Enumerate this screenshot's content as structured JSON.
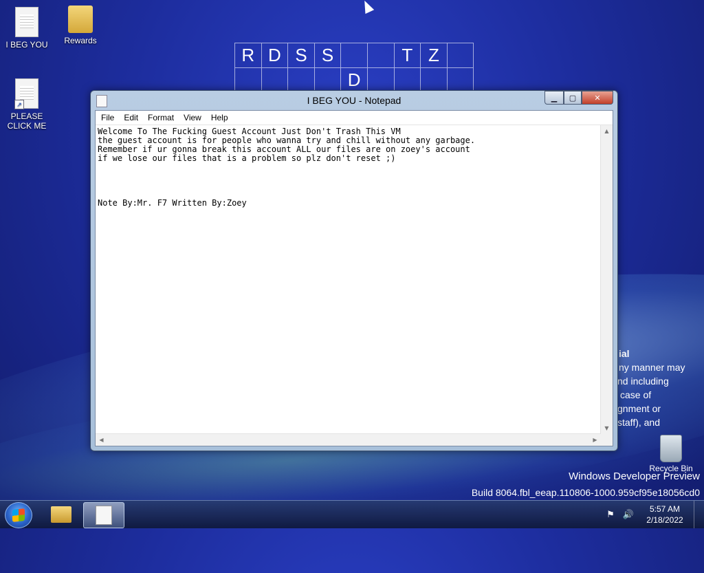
{
  "crossword": {
    "row1": [
      "R",
      "D",
      "S",
      "S",
      "",
      "",
      "T",
      "Z",
      ""
    ],
    "row2": [
      "",
      "",
      "",
      "",
      "D",
      "",
      "",
      "",
      ""
    ]
  },
  "desktop": {
    "icon_beg_you": "I BEG YOU",
    "icon_rewards": "Rewards",
    "icon_please_click": "PLEASE CLICK ME",
    "recycle_bin": "Recycle Bin"
  },
  "wallpaper_text": {
    "line1": "ial",
    "line2": "ny manner may",
    "line3": "nd including",
    "line4": "case of",
    "line5": "gnment or",
    "line6": "staff), and"
  },
  "watermark": {
    "line1": "Windows Developer Preview",
    "line2": "Build 8064.fbl_eeap.110806-1000.959cf95e18056cd0"
  },
  "notepad": {
    "title": "I BEG YOU - Notepad",
    "menu": {
      "file": "File",
      "edit": "Edit",
      "format": "Format",
      "view": "View",
      "help": "Help"
    },
    "content": "Welcome To The Fucking Guest Account Just Don't Trash This VM\nthe guest account is for people who wanna try and chill without any garbage.\nRemember if ur gonna break this account ALL our files are on zoey's account\nif we lose our files that is a problem so plz don't reset ;)\n\n\n\n\nNote By:Mr. F7 Written By:Zoey"
  },
  "taskbar": {
    "time": "5:57 AM",
    "date": "2/18/2022"
  },
  "icons": {
    "start": "windows-start-orb",
    "explorer": "folder-icon",
    "notepad": "notepad-icon",
    "flag": "action-center-flag-icon",
    "volume": "speaker-icon"
  }
}
